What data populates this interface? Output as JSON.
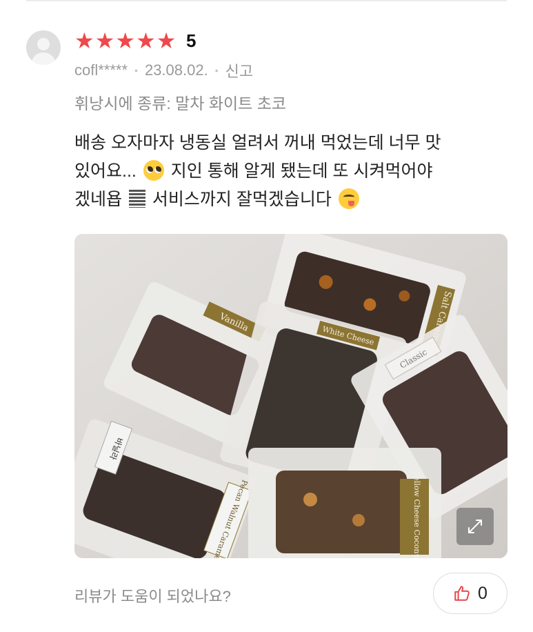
{
  "review": {
    "rating": {
      "stars": 5,
      "score_label": "5",
      "star_color": "#f0484b"
    },
    "author": "cofl*****",
    "date": "23.08.02.",
    "report_label": "신고",
    "option_text": "휘낭시에 종류: 말차 화이트 초코",
    "body_lines": [
      "배송 오자마자 냉동실 얼려서 꺼내 먹었는데 너무 맛",
      "있어요...",
      "지인 통해 알게 됐는데 또 시켜먹어야",
      "겠네욥",
      "서비스까지 잘먹겠습니다"
    ],
    "emoji": [
      "pleading-face",
      "lines-icon",
      "yum-face"
    ]
  },
  "photo": {
    "labels": [
      "Vanilla",
      "Salt Caramel",
      "White Cheese",
      "Classic",
      "바닐라",
      "Pecan Walnut Caramel",
      "Yellow Cheese Coconut"
    ]
  },
  "footer": {
    "helpful_question": "리뷰가 도움이 되었나요?",
    "like_count": "0",
    "like_color": "#e8434a"
  }
}
